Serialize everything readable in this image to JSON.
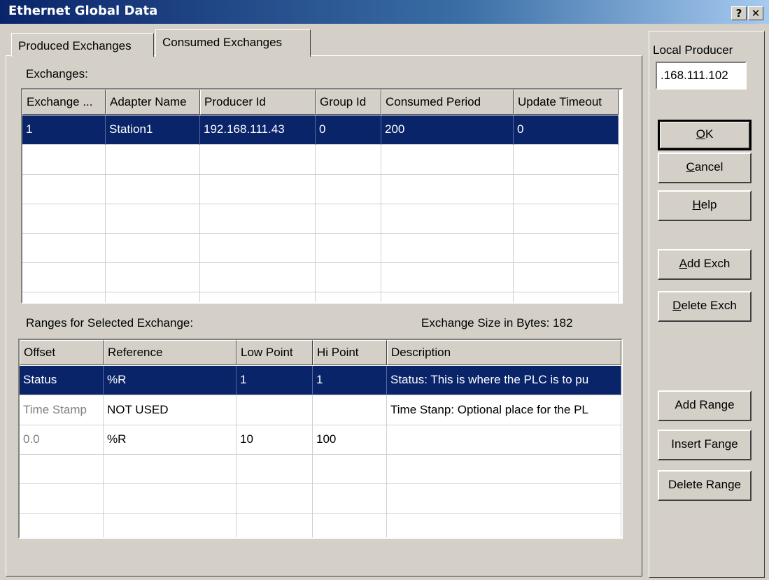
{
  "window": {
    "title": "Ethernet Global Data",
    "help_glyph": "?",
    "close_glyph": "✕"
  },
  "tabs": [
    {
      "label": "Produced Exchanges"
    },
    {
      "label": "Consumed Exchanges"
    }
  ],
  "exchanges": {
    "label": "Exchanges:",
    "columns": [
      "Exchange ...",
      "Adapter Name",
      "Producer Id",
      "Group Id",
      "Consumed Period",
      "Update Timeout"
    ],
    "rows": [
      [
        "1",
        "Station1",
        "192.168.111.43",
        "0",
        "200",
        "0"
      ]
    ]
  },
  "ranges": {
    "label": "Ranges for Selected Exchange:",
    "size_text": "Exchange Size in Bytes: 182",
    "columns": [
      "Offset",
      "Reference",
      "Low Point",
      "Hi Point",
      "Description"
    ],
    "rows": [
      [
        "Status",
        "%R",
        "1",
        "1",
        "Status: This is where the PLC is to pu"
      ],
      [
        "Time Stamp",
        "NOT USED",
        "",
        "",
        "Time Stanp: Optional place for the PL"
      ],
      [
        "0.0",
        "%R",
        "10",
        "100",
        ""
      ]
    ]
  },
  "side": {
    "local_producer_label": "Local Producer",
    "local_producer_value": ".168.111.102",
    "ok": {
      "pre": "",
      "key": "O",
      "post": "K"
    },
    "cancel": {
      "pre": "",
      "key": "C",
      "post": "ancel"
    },
    "help": {
      "pre": "",
      "key": "H",
      "post": "elp"
    },
    "add_exch": {
      "pre": "",
      "key": "A",
      "post": "dd Exch"
    },
    "delete_exch": {
      "pre": "",
      "key": "D",
      "post": "elete Exch"
    },
    "add_range": "Add Range",
    "insert_range": "Insert Fange",
    "delete_range": "Delete Range"
  },
  "colors": {
    "selection": "#0a246a",
    "face": "#d4d0c8",
    "grid_line": "#d0d0d0",
    "dim_text": "#808080"
  }
}
